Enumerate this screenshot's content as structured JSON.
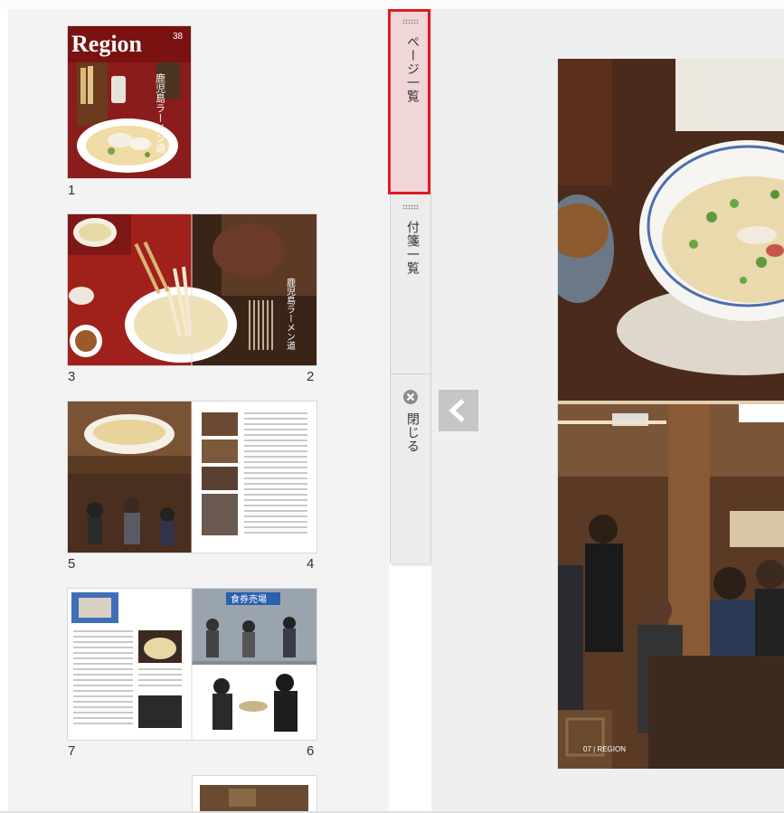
{
  "sidebar": {
    "thumbs": [
      {
        "page": "1"
      },
      {
        "left_page": "3",
        "right_page": "2"
      },
      {
        "left_page": "5",
        "right_page": "4"
      },
      {
        "left_page": "7",
        "right_page": "6"
      }
    ],
    "cover": {
      "logo": "Region",
      "issue": "38",
      "title_vertical": "鹿児島ラーメン道"
    },
    "spread_title": "鹿児島ラーメン道",
    "page6_sign": "食券売場"
  },
  "tabs": {
    "pages_list": "ページ一覧",
    "bookmarks_list": "付箋一覧",
    "close": "閉じる",
    "close_icon": "close-icon",
    "collapse_icon": "chevron-left-icon"
  },
  "viewer": {
    "footer_text": "07 | REGION"
  },
  "colors": {
    "active_tab_bg": "#f1d6d8",
    "highlight_border": "#e01b24",
    "sidebar_bg": "#f3f3f3",
    "viewer_bg": "#efefef"
  }
}
